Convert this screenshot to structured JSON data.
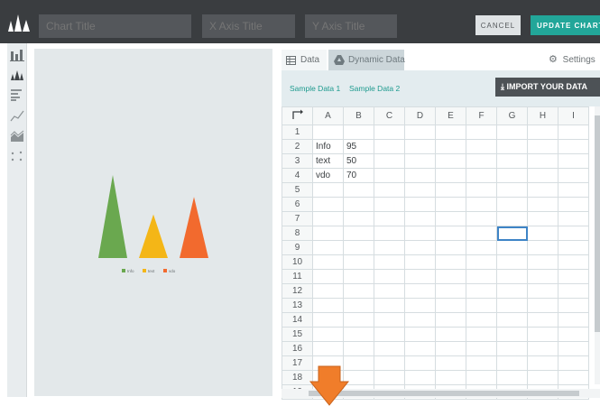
{
  "header": {
    "chart_title_placeholder": "Chart Title",
    "x_axis_placeholder": "X Axis Title",
    "y_axis_placeholder": "Y Axis Title",
    "cancel_label": "CANCEL",
    "update_label": "UPDATE CHART"
  },
  "sidebar": {
    "icons": [
      "bar-chart-icon",
      "triangle-chart-icon",
      "horizontal-bar-icon",
      "line-chart-icon",
      "area-chart-icon",
      "scatter-chart-icon"
    ]
  },
  "chart_data": {
    "type": "bar",
    "categories": [
      "Info",
      "text",
      "vdo"
    ],
    "values": [
      95,
      50,
      70
    ],
    "colors": [
      "#6aa84f",
      "#f4b617",
      "#f26a2e"
    ],
    "legend": [
      "Info",
      "text",
      "vdo"
    ],
    "title": "",
    "xlabel": "",
    "ylabel": ""
  },
  "panel": {
    "tab_data": "Data",
    "tab_dynamic": "Dynamic Data",
    "settings": "Settings",
    "sample1": "Sample Data 1",
    "sample2": "Sample Data 2",
    "import_label": "IMPORT YOUR DATA"
  },
  "grid": {
    "columns": [
      "A",
      "B",
      "C",
      "D",
      "E",
      "F",
      "G",
      "H",
      "I"
    ],
    "rows": [
      [
        "",
        ""
      ],
      [
        "Info",
        "95"
      ],
      [
        "text",
        "50"
      ],
      [
        "vdo",
        "70"
      ],
      [
        "",
        ""
      ],
      [
        "",
        ""
      ],
      [
        "",
        ""
      ],
      [
        "",
        ""
      ],
      [
        "",
        ""
      ],
      [
        "",
        ""
      ],
      [
        "",
        ""
      ],
      [
        "",
        ""
      ],
      [
        "",
        ""
      ],
      [
        "",
        ""
      ],
      [
        "",
        ""
      ],
      [
        "",
        ""
      ],
      [
        "",
        ""
      ],
      [
        "",
        ""
      ],
      [
        "",
        ""
      ]
    ],
    "selected_cell": "G8"
  },
  "colors": {
    "accent": "#22a699",
    "topbar": "#3a3d40",
    "selection": "#3e84c6",
    "arrow": "#f07d2a"
  }
}
